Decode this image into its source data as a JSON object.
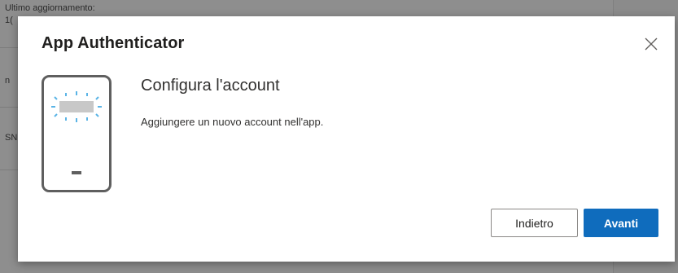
{
  "background": {
    "last_update_label": "Ultimo aggiornamento:",
    "value_fragment": "1(",
    "side_fragment_1": "n",
    "side_fragment_2": "SN"
  },
  "dialog": {
    "title": "App Authenticator",
    "close_icon": "close-icon",
    "illustration_icon": "phone-scan-icon",
    "heading": "Configura l'account",
    "description": "Aggiungere un nuovo account nell'app.",
    "back_label": "Indietro",
    "next_label": "Avanti"
  },
  "colors": {
    "primary": "#0f6cbd",
    "scan_accent": "#5ab4e6",
    "phone_outline": "#5f5f5f",
    "overlay": "#8b8b8b"
  }
}
